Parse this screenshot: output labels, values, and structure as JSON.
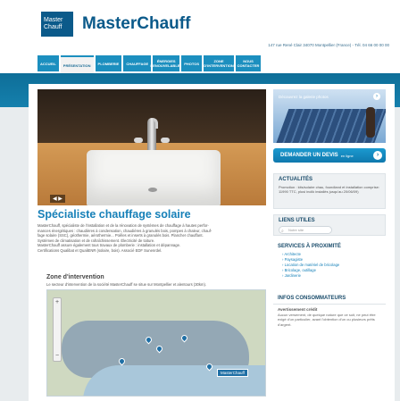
{
  "brand": {
    "logo_line1": "Master",
    "logo_line2": "Chauff",
    "name": "MasterChauff",
    "address": "147 rue René Clair 34070 Montpellier (France) - Tél. 04 66 00 00 00"
  },
  "nav": {
    "items": [
      {
        "label": "ACCUEIL"
      },
      {
        "label": "PRÉSENTATION",
        "active": true
      },
      {
        "label": "PLOMBERIE"
      },
      {
        "label": "CHAUFFAGE"
      },
      {
        "label": "ÉNERGIES RENOUVELABLES"
      },
      {
        "label": "PHOTOS"
      },
      {
        "label": "ZONE D'INTERVENTION"
      },
      {
        "label": "NOUS CONTACTER"
      }
    ]
  },
  "hero": {
    "controls": "◀ ▶"
  },
  "main": {
    "title": "Spécialiste chauffage solaire",
    "intro": [
      "MasterChauff, spécialiste de l'installation et de la rénovation de systèmes de chauffage à hautes perfor-",
      "mances énergétiques : chaudières à condensation, chaudières à granulés bois, pompes à chaleur, chauf-",
      "fage solaire (SSC), géothermie, aérothermie... Poêles et inserts à granulés bois. Plancher chauffant.",
      "Systèmes de climatisation et de rafraîchissement. Électricité de toiture.",
      "MasterChauff assure également tous travaux de plomberie : installation et dépannage.",
      "Certifications Qualibat et QualiENR (solaire, bois). Associé EDF Sunenrdel."
    ],
    "zone_title": "Zone d'intervention",
    "zone_sub": "Le secteur d'intervention de la société MasterChauff se situe sur Montpellier et alentours (30km).",
    "map_badge": "MasterChauff",
    "zoom_plus": "+",
    "zoom_minus": "−"
  },
  "sidebar": {
    "photo_caption": "Découvrez la galerie photos",
    "photo_arrow": "›",
    "devis_label": "DEMANDER UN DEVIS",
    "devis_small": "en ligne",
    "devis_go": "›",
    "actu_title": "ACTUALITÉS",
    "actu_text": "Promotion : kits/solaire chau, foundland et installation comprise: 11990 TTC, plusi inclik installés jusqu'au 20/06/09)",
    "liens_title": "LIENS UTILES",
    "search_placeholder": "Notre site",
    "services_title": "SERVICES À PROXIMITÉ",
    "services": [
      "Architecte",
      "Paysagiste",
      "Location de matériel de bricolage",
      "Bricolage, outillage",
      "Jardinerie"
    ],
    "infos_title": "INFOS CONSOMMATEURS",
    "infos_sub": "Avertissement crédit",
    "infos_text": "Aucun versement, de quelque nature que ce soit, ne peut être exigé d'un particulier, avant l'obtention d'un ou plusieurs prêts d'argent."
  }
}
